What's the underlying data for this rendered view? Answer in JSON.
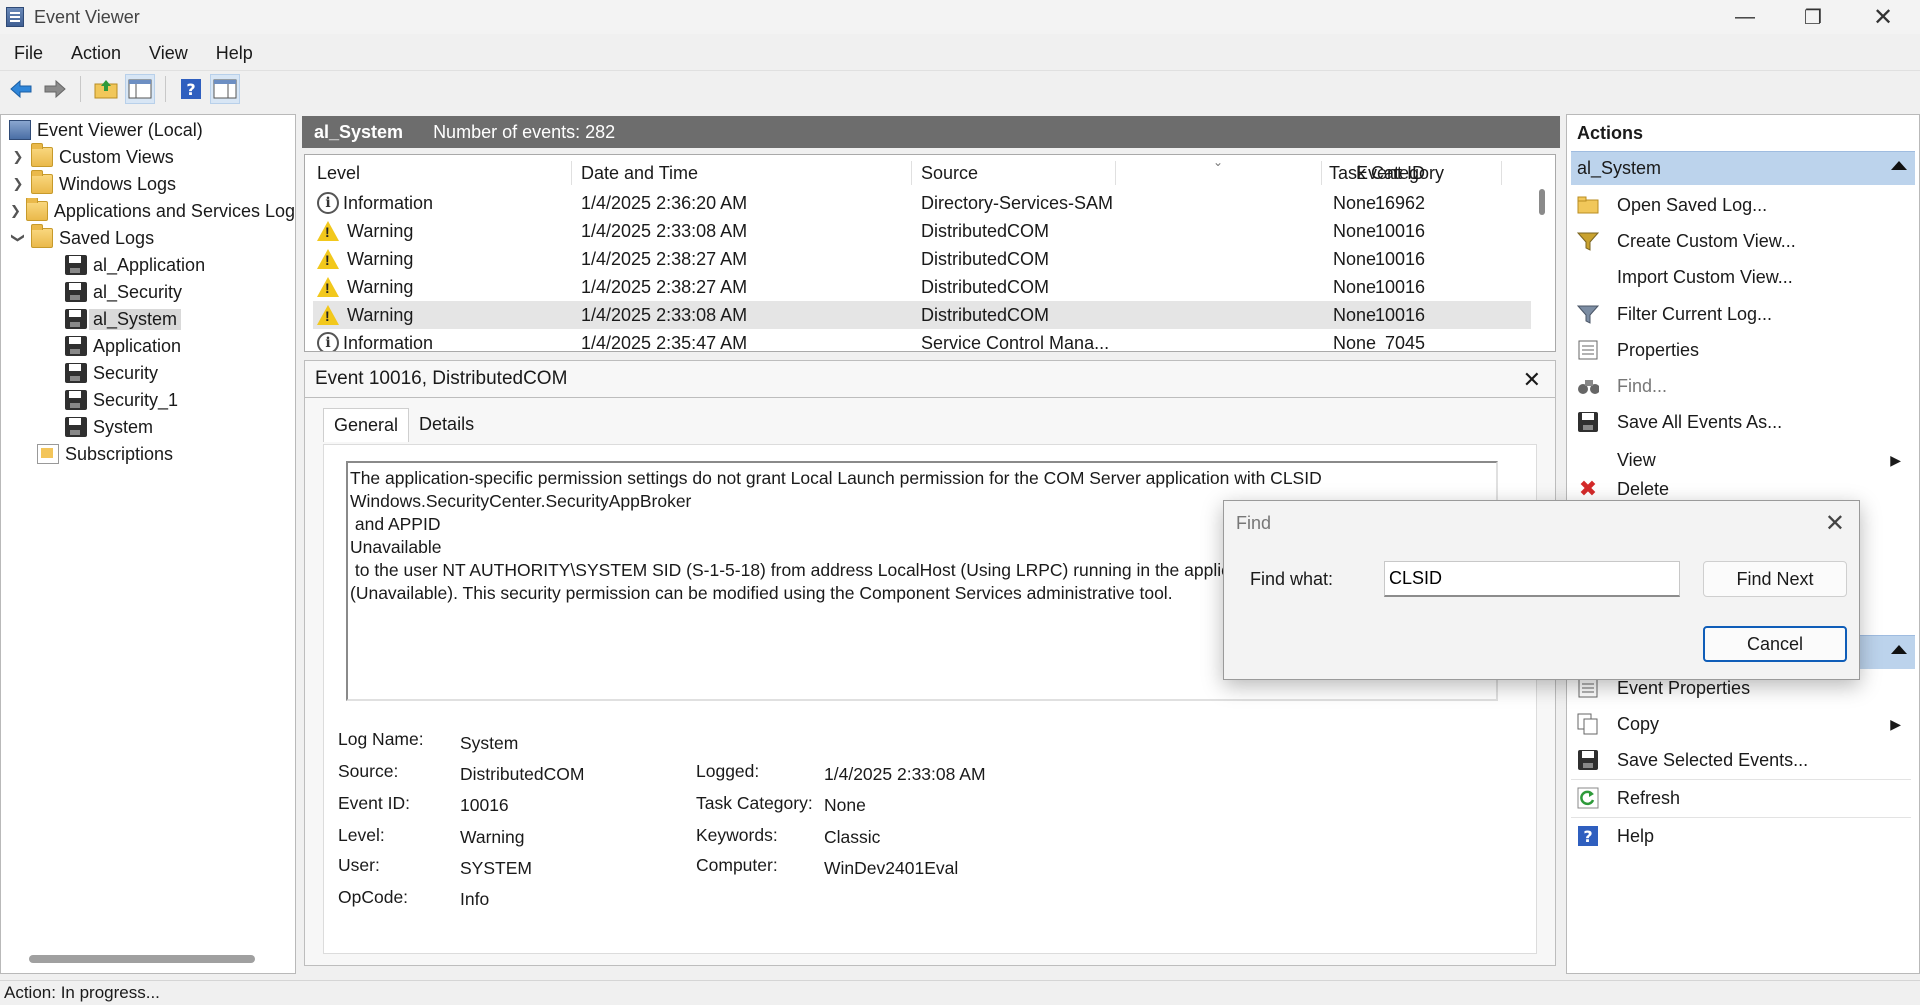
{
  "window": {
    "title": "Event Viewer"
  },
  "menu": [
    "File",
    "Action",
    "View",
    "Help"
  ],
  "tree": {
    "root": "Event Viewer (Local)",
    "custom_views": "Custom Views",
    "windows_logs": "Windows Logs",
    "app_services": "Applications and Services Log",
    "saved_logs": "Saved Logs",
    "saved_items": [
      "al_Application",
      "al_Security",
      "al_System",
      "Application",
      "Security",
      "Security_1",
      "System"
    ],
    "subscriptions": "Subscriptions",
    "selected": "al_System"
  },
  "center": {
    "log_name": "al_System",
    "event_count": "Number of events: 282",
    "columns": [
      "Level",
      "Date and Time",
      "Source",
      "Event ID",
      "Task Category"
    ],
    "rows": [
      {
        "level": "Information",
        "datetime": "1/4/2025 2:36:20 AM",
        "source": "Directory-Services-SAM",
        "event_id": "16962",
        "category": "None"
      },
      {
        "level": "Warning",
        "datetime": "1/4/2025 2:33:08 AM",
        "source": "DistributedCOM",
        "event_id": "10016",
        "category": "None"
      },
      {
        "level": "Warning",
        "datetime": "1/4/2025 2:38:27 AM",
        "source": "DistributedCOM",
        "event_id": "10016",
        "category": "None"
      },
      {
        "level": "Warning",
        "datetime": "1/4/2025 2:38:27 AM",
        "source": "DistributedCOM",
        "event_id": "10016",
        "category": "None"
      },
      {
        "level": "Warning",
        "datetime": "1/4/2025 2:33:08 AM",
        "source": "DistributedCOM",
        "event_id": "10016",
        "category": "None"
      },
      {
        "level": "Information",
        "datetime": "1/4/2025 2:35:47 AM",
        "source": "Service Control Mana...",
        "event_id": "7045",
        "category": "None"
      }
    ]
  },
  "detail": {
    "title": "Event 10016, DistributedCOM",
    "tabs": [
      "General",
      "Details"
    ],
    "description": "The application-specific permission settings do not grant Local Launch permission for the COM Server application with CLSID\nWindows.SecurityCenter.SecurityAppBroker\n and APPID\nUnavailable\n to the user NT AUTHORITY\\SYSTEM SID (S-1-5-18) from address LocalHost (Using LRPC) running in the application container Unavailable SID\n(Unavailable). This security permission can be modified using the Component Services administrative tool.",
    "props": {
      "log_name_label": "Log Name:",
      "log_name": "System",
      "source_label": "Source:",
      "source": "DistributedCOM",
      "event_id_label": "Event ID:",
      "event_id": "10016",
      "level_label": "Level:",
      "level": "Warning",
      "user_label": "User:",
      "user": "SYSTEM",
      "opcode_label": "OpCode:",
      "opcode": "Info",
      "logged_label": "Logged:",
      "logged": "1/4/2025 2:33:08 AM",
      "task_label": "Task Category:",
      "task": "None",
      "keywords_label": "Keywords:",
      "keywords": "Classic",
      "computer_label": "Computer:",
      "computer": "WinDev2401Eval"
    }
  },
  "actions": {
    "title": "Actions",
    "section1": "al_System",
    "items1": [
      "Open Saved Log...",
      "Create Custom View...",
      "Import Custom View...",
      "Filter Current Log...",
      "Properties",
      "Find...",
      "Save All Events As...",
      "View",
      "Delete"
    ],
    "items2": [
      "Event Properties",
      "Copy",
      "Save Selected Events...",
      "Refresh",
      "Help"
    ]
  },
  "status": "Action:  In progress...",
  "find_dialog": {
    "title": "Find",
    "label": "Find what:",
    "value": "CLSID",
    "find_next": "Find Next",
    "cancel": "Cancel"
  }
}
